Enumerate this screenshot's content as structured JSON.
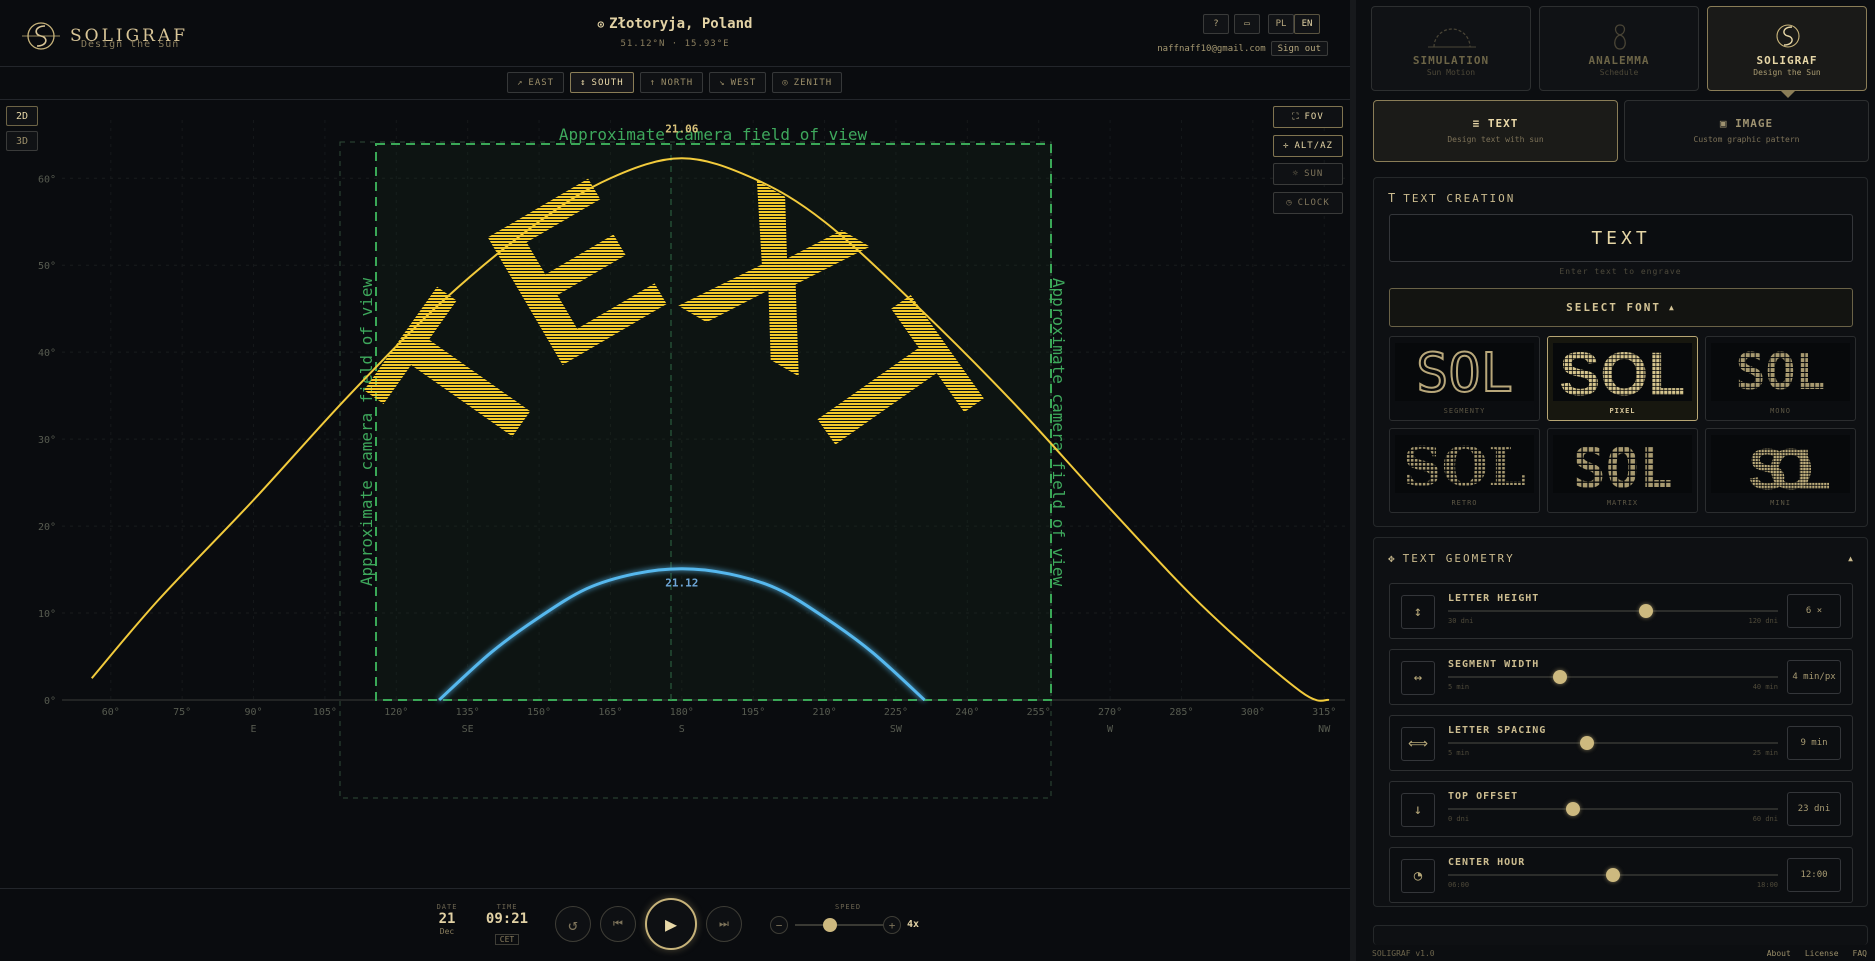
{
  "brand": {
    "name": "SOLIGRAF",
    "tagline": "Design the Sun"
  },
  "location": {
    "city": "Złotoryja, Poland",
    "coords": "51.12°N · 15.93°E"
  },
  "topbar": {
    "help": "?",
    "lang_pl": "PL",
    "lang_en": "EN",
    "email": "naffnaff10@gmail.com",
    "signout": "Sign out"
  },
  "directions": [
    {
      "label": "EAST",
      "icon": "↗"
    },
    {
      "label": "SOUTH",
      "icon": "↕"
    },
    {
      "label": "NORTH",
      "icon": "↑"
    },
    {
      "label": "WEST",
      "icon": "↘"
    },
    {
      "label": "ZENITH",
      "icon": "◎"
    }
  ],
  "view_modes": {
    "d2": "2D",
    "d3": "3D"
  },
  "tools": {
    "fov": "FOV",
    "altaz": "ALT/AZ",
    "sun": "SUN",
    "clock": "CLOCK"
  },
  "chart_data": {
    "type": "line",
    "x_ticks": [
      "60°",
      "75°",
      "90°",
      "105°",
      "120°",
      "135°",
      "150°",
      "165°",
      "180°",
      "195°",
      "210°",
      "225°",
      "240°",
      "255°",
      "270°",
      "285°",
      "300°",
      "315°"
    ],
    "y_ticks": [
      "0°",
      "10°",
      "20°",
      "30°",
      "40°",
      "50°",
      "60°"
    ],
    "compass": [
      "E",
      "SE",
      "S",
      "SW",
      "W",
      "NW"
    ],
    "xlim": [
      55,
      320
    ],
    "ylim": [
      0,
      69
    ],
    "fov_label": "Approximate camera field of view",
    "series": [
      {
        "color": "#f2cb3c",
        "peak_label": "21.06",
        "x": [
          56,
          70,
          90,
          110,
          130,
          150,
          165,
          180,
          195,
          210,
          230,
          250,
          270,
          290,
          310,
          316
        ],
        "y": [
          2.5,
          11.5,
          23,
          35,
          46,
          55,
          60,
          62.3,
          60,
          55,
          45,
          34,
          22,
          10.5,
          1,
          0
        ]
      },
      {
        "color": "#56b8ee",
        "peak_label": "21.12",
        "x": [
          129,
          140,
          150,
          160,
          170,
          180,
          190,
          200,
          210,
          220,
          231
        ],
        "y": [
          0,
          5.5,
          9.5,
          12.8,
          14.5,
          15.1,
          14.5,
          12.8,
          9.5,
          5.5,
          0
        ]
      }
    ],
    "engraving": "TEXT"
  },
  "playback": {
    "date_k": "DATE",
    "date_v": "21",
    "date_s": "Dec",
    "time_k": "TIME",
    "time_v": "09:21",
    "time_s": "CET",
    "speed_k": "SPEED",
    "speed_v": "4x",
    "speed_level": 0.35
  },
  "modes": [
    {
      "title": "SIMULATION",
      "sub": "Sun Motion"
    },
    {
      "title": "ANALEMMA",
      "sub": "Schedule"
    },
    {
      "title": "SOLIGRAF",
      "sub": "Design the Sun"
    }
  ],
  "subtabs": [
    {
      "title": "TEXT",
      "sub": "Design text with sun"
    },
    {
      "title": "IMAGE",
      "sub": "Custom graphic pattern"
    }
  ],
  "text_creation": {
    "title": "TEXT CREATION",
    "value": "TEXT",
    "hint": "Enter text to engrave",
    "select_font": "SELECT FONT"
  },
  "fonts": [
    {
      "preview": "SOL",
      "label": "SEGMENTY"
    },
    {
      "preview": "SOL",
      "label": "PIXEL"
    },
    {
      "preview": "SOL",
      "label": "MONO"
    },
    {
      "preview": "SOL",
      "label": "RETRO"
    },
    {
      "preview": "SOL",
      "label": "MATRIX"
    },
    {
      "preview": "SOL",
      "label": "MINI"
    }
  ],
  "geometry": {
    "title": "TEXT GEOMETRY",
    "rows": [
      {
        "label": "LETTER HEIGHT",
        "min": "30 dni",
        "max": "120 dni",
        "value": "6 ×",
        "level": 0.6
      },
      {
        "label": "SEGMENT WIDTH",
        "min": "5 min",
        "max": "40 min",
        "value": "4 min/px",
        "level": 0.34
      },
      {
        "label": "LETTER SPACING",
        "min": "5 min",
        "max": "25 min",
        "value": "9 min",
        "level": 0.42
      },
      {
        "label": "TOP OFFSET",
        "min": "0 dni",
        "max": "60 dni",
        "value": "23 dni",
        "level": 0.38
      },
      {
        "label": "CENTER HOUR",
        "min": "06:00",
        "max": "18:00",
        "value": "12:00",
        "level": 0.5
      }
    ]
  },
  "footer": {
    "version": "SOLIGRAF v1.0",
    "about": "About",
    "license": "License",
    "faq": "FAQ"
  }
}
